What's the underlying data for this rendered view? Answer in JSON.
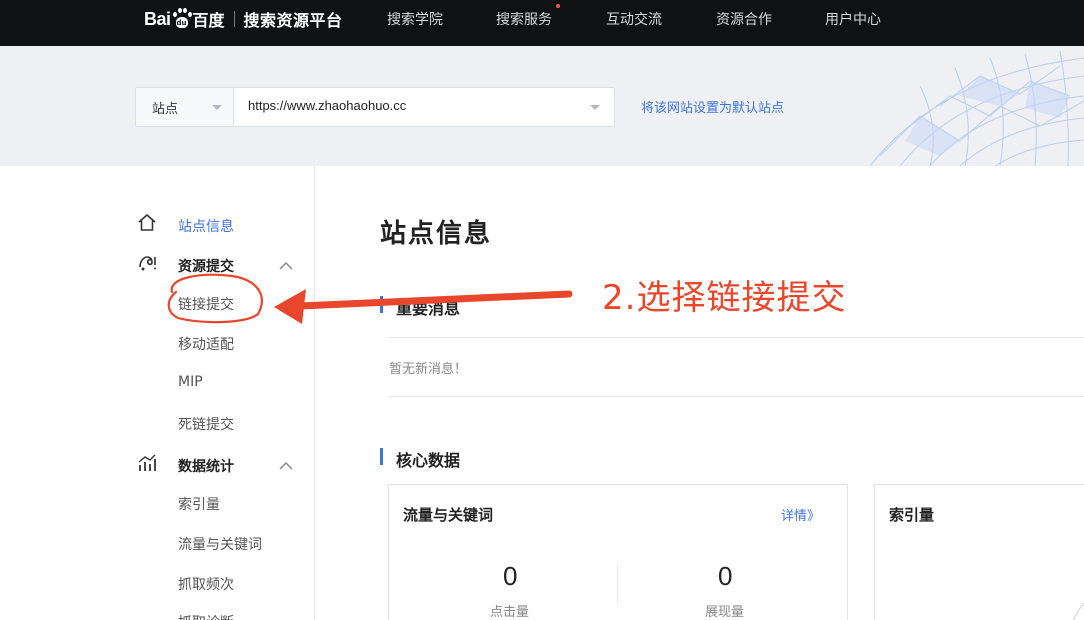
{
  "logo": {
    "bai": "Bai",
    "du": "du",
    "baidu_cn": "百度",
    "platform": "搜索资源平台"
  },
  "nav": {
    "items": [
      {
        "label": "搜索学院"
      },
      {
        "label": "搜索服务",
        "has_dot": true
      },
      {
        "label": "互动交流"
      },
      {
        "label": "资源合作"
      },
      {
        "label": "用户中心"
      }
    ]
  },
  "site_bar": {
    "select_label": "站点",
    "url": "https://www.zhaohaohuo.cc",
    "set_default_link": "将该网站设置为默认站点"
  },
  "sidebar": {
    "site_info": "站点信息",
    "resource_submit": {
      "label": "资源提交",
      "items": [
        "链接提交",
        "移动适配",
        "MIP",
        "死链提交"
      ]
    },
    "data_stats": {
      "label": "数据统计",
      "items": [
        "索引量",
        "流量与关键词",
        "抓取频次",
        "抓取诊断"
      ]
    }
  },
  "main": {
    "title": "站点信息",
    "important_msgs": {
      "title": "重要消息",
      "empty_text": "暂无新消息！"
    },
    "core_data": {
      "title": "核心数据",
      "traffic_card": {
        "title": "流量与关键词",
        "details_link": "详情》",
        "clicks_value": "0",
        "clicks_label": "点击量",
        "impressions_value": "0",
        "impressions_label": "展现量"
      },
      "index_card": {
        "title": "索引量"
      }
    }
  },
  "annotation": {
    "text": "2.选择链接提交",
    "color": "#e8472b"
  },
  "colors": {
    "accent": "#3d75d9",
    "topbar": "#101112",
    "notification_dot": "#f25d4d"
  }
}
